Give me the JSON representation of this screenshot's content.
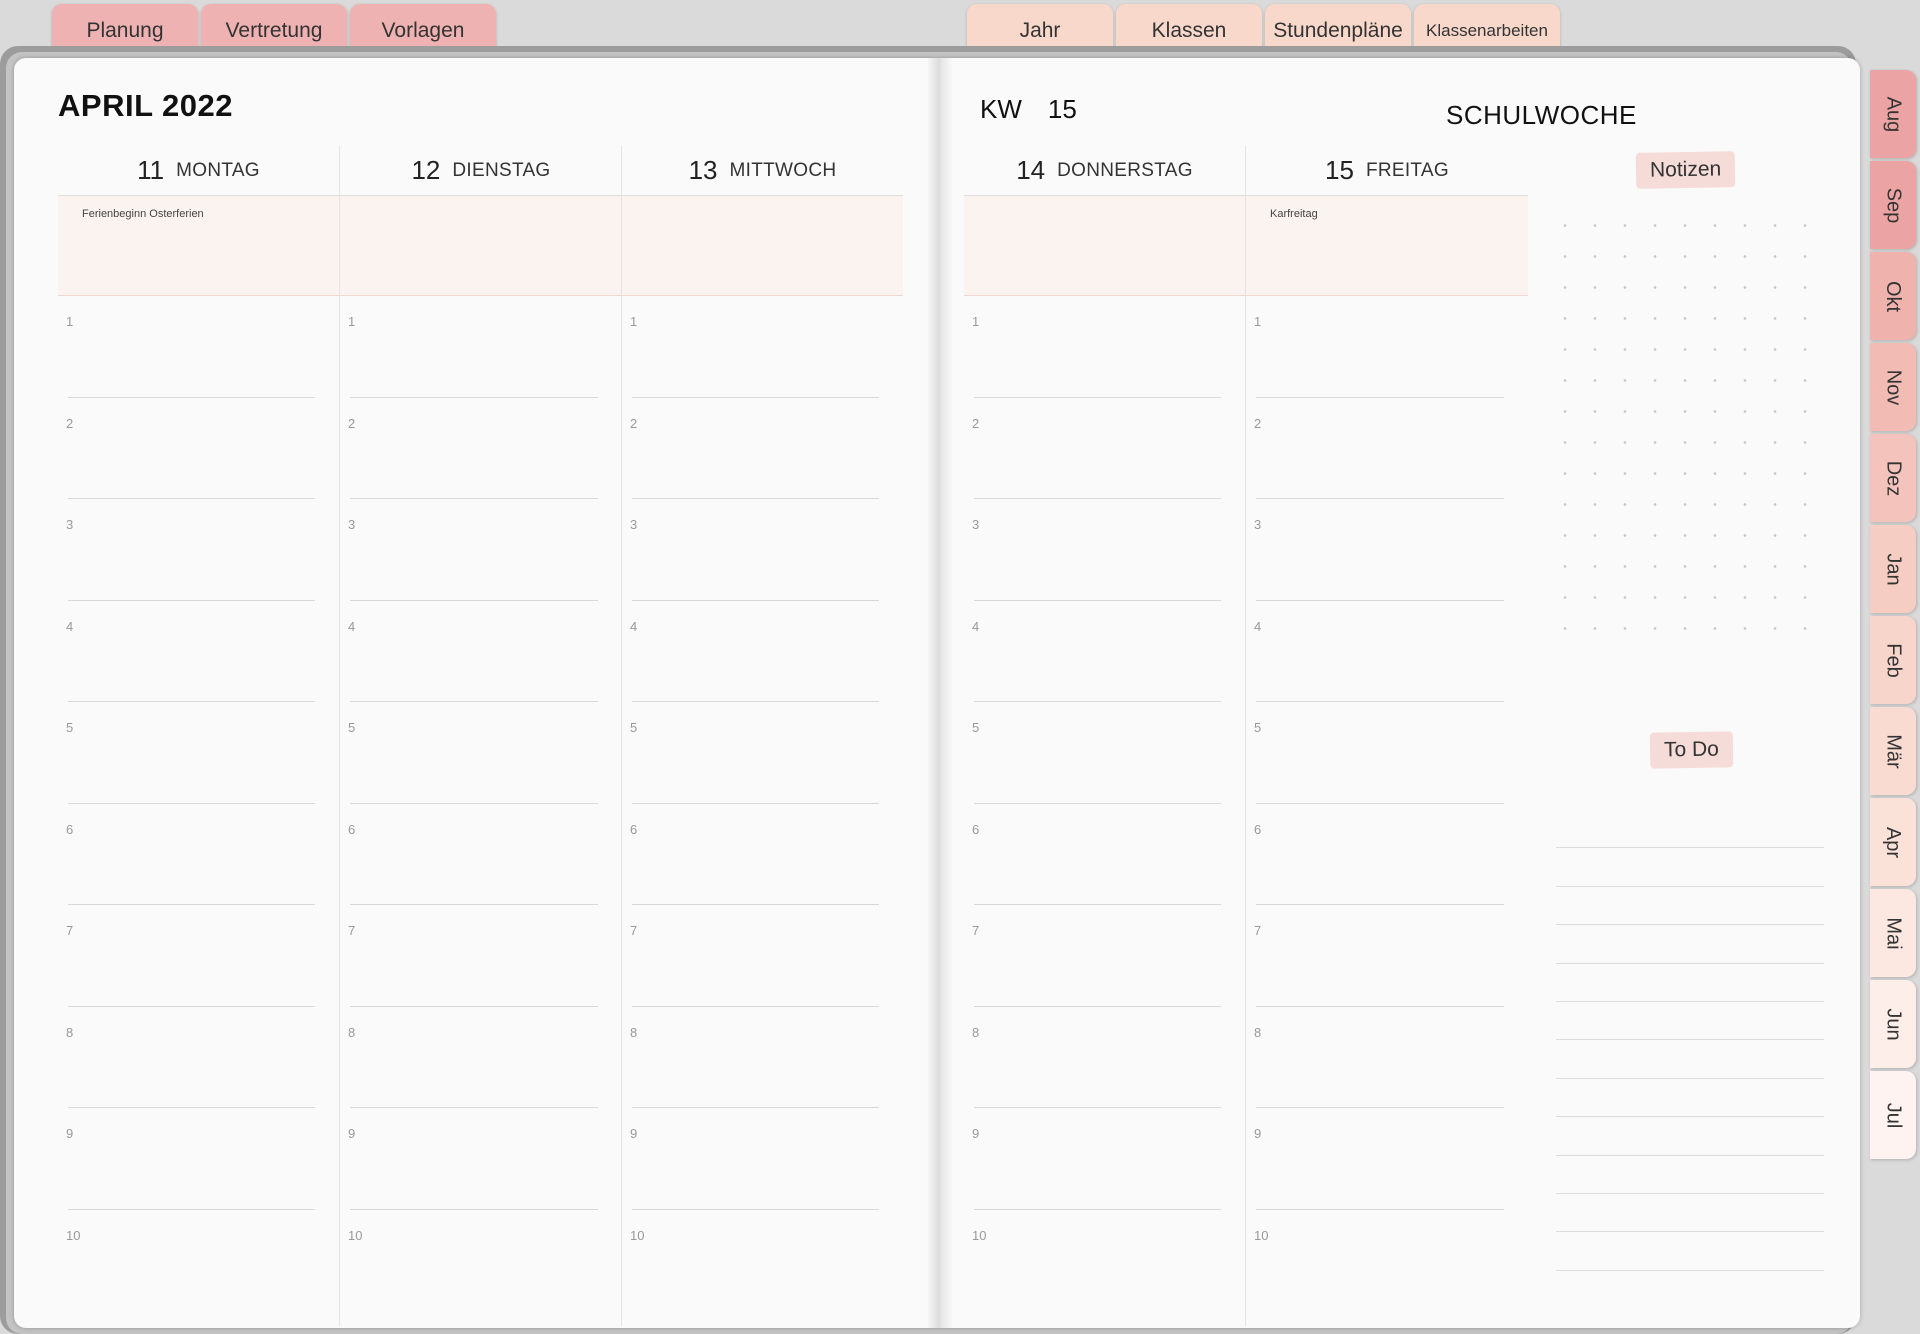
{
  "top_tabs_left": [
    {
      "label": "Planung",
      "color": "#efb2b2"
    },
    {
      "label": "Vertretung",
      "color": "#efb2b2"
    },
    {
      "label": "Vorlagen",
      "color": "#efb2b2"
    }
  ],
  "top_tabs_right": [
    {
      "label": "Jahr",
      "color": "#f9d8cc"
    },
    {
      "label": "Klassen",
      "color": "#f9d8cc"
    },
    {
      "label": "Stundenpläne",
      "color": "#f9d8cc"
    },
    {
      "label": "Klassenarbeiten",
      "color": "#f9d8cc"
    }
  ],
  "header": {
    "month_title": "APRIL 2022",
    "kw_label": "KW",
    "kw_number": "15",
    "week_type": "SCHULWOCHE"
  },
  "days": [
    {
      "num": "11",
      "name": "MONTAG",
      "event": "Ferienbeginn Osterferien"
    },
    {
      "num": "12",
      "name": "DIENSTAG",
      "event": ""
    },
    {
      "num": "13",
      "name": "MITTWOCH",
      "event": ""
    },
    {
      "num": "14",
      "name": "DONNERSTAG",
      "event": ""
    },
    {
      "num": "15",
      "name": "FREITAG",
      "event": "Karfreitag"
    }
  ],
  "slot_numbers": [
    "1",
    "2",
    "3",
    "4",
    "5",
    "6",
    "7",
    "8",
    "9",
    "10"
  ],
  "notes": {
    "notizen_label": "Notizen",
    "todo_label": "To Do"
  },
  "month_tabs": [
    {
      "label": "Aug",
      "color": "#eba3a3"
    },
    {
      "label": "Sep",
      "color": "#eba3a3"
    },
    {
      "label": "Okt",
      "color": "#efb2ad"
    },
    {
      "label": "Nov",
      "color": "#f2bcb5"
    },
    {
      "label": "Dez",
      "color": "#f4c4bc"
    },
    {
      "label": "Jan",
      "color": "#f6cdc3"
    },
    {
      "label": "Feb",
      "color": "#f8d5ca"
    },
    {
      "label": "Mär",
      "color": "#f9dbd1"
    },
    {
      "label": "Apr",
      "color": "#fbe2d9"
    },
    {
      "label": "Mai",
      "color": "#fce8e1"
    },
    {
      "label": "Jun",
      "color": "#fdeee9"
    },
    {
      "label": "Jul",
      "color": "#fef3f0"
    }
  ]
}
